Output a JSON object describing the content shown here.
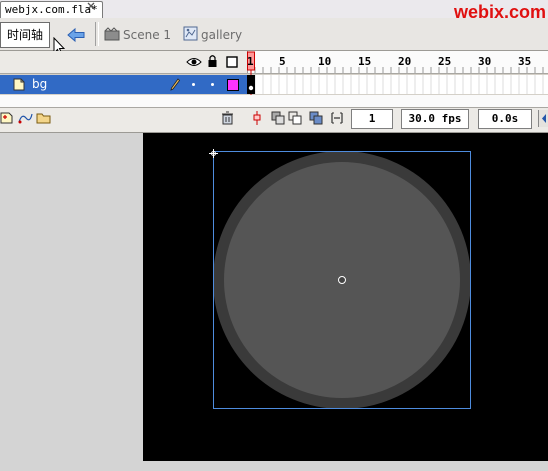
{
  "document": {
    "tab_title": "webjx.com.fla*"
  },
  "watermark": "webjx.com",
  "edit_bar": {
    "timeline_label": "时间轴",
    "scene_label": "Scene 1",
    "symbol_label": "gallery"
  },
  "timeline": {
    "frame_numbers": [
      "1",
      "5",
      "10",
      "15",
      "20",
      "25",
      "30",
      "35"
    ],
    "layer": {
      "name": "bg"
    },
    "current_frame": "1",
    "frame_rate": "30.0 fps",
    "elapsed_time": "0.0s"
  },
  "colors": {
    "selection_highlight": "#316ac5",
    "layer_outline_color": "#ff33ff",
    "stage_background": "#000000",
    "circle_outer": "#3a3a3a",
    "circle_inner": "#555555",
    "watermark": "#e01010"
  },
  "icons": {
    "eye": "eye-icon",
    "lock": "lock-icon",
    "outline": "outline-icon",
    "pencil": "pencil-icon",
    "layer": "layer-icon",
    "trash": "trash-icon",
    "back": "back-arrow-icon",
    "scene": "scene-icon",
    "symbol": "movie-clip-icon"
  }
}
